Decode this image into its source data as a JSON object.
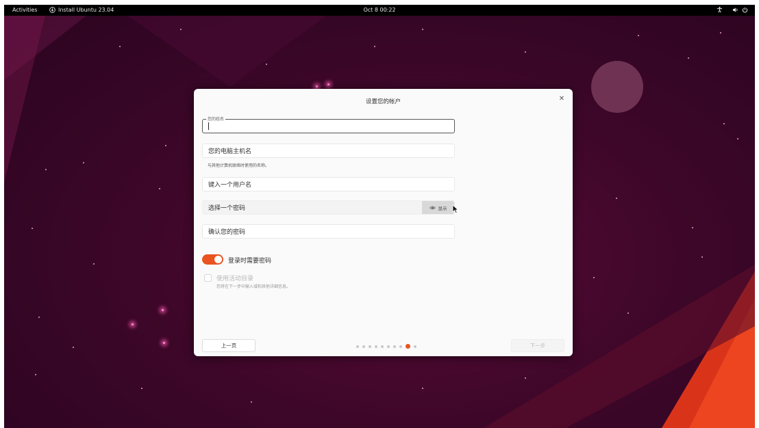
{
  "topbar": {
    "activities": "Activities",
    "app_name": "Install Ubuntu 23.04",
    "clock": "Oct 8  00:22"
  },
  "dialog": {
    "title": "设置您的帐户",
    "name_label": "您的姓名",
    "computer_name_placeholder": "您的电脑主机名",
    "computer_name_hint": "与其他计算机联络时使用的名称。",
    "username_placeholder": "键入一个用户名",
    "password_placeholder": "选择一个密码",
    "show_label": "显示",
    "confirm_placeholder": "确认您的密码",
    "require_password_label": "登录时需要密码",
    "active_directory_label": "使用活动目录",
    "active_directory_hint": "您将在下一步中输入域和其他详细信息。",
    "back_label": "上一页",
    "next_label": "下一步",
    "pager": {
      "total": 10,
      "active_index": 8
    }
  },
  "colors": {
    "accent": "#e95420",
    "wallpaper": "#3e0729",
    "topbar": "#000000"
  },
  "icons": [
    "installer-icon",
    "accessibility-icon",
    "volume-icon",
    "power-icon",
    "close-icon",
    "eye-icon",
    "mouse-pointer-icon"
  ]
}
